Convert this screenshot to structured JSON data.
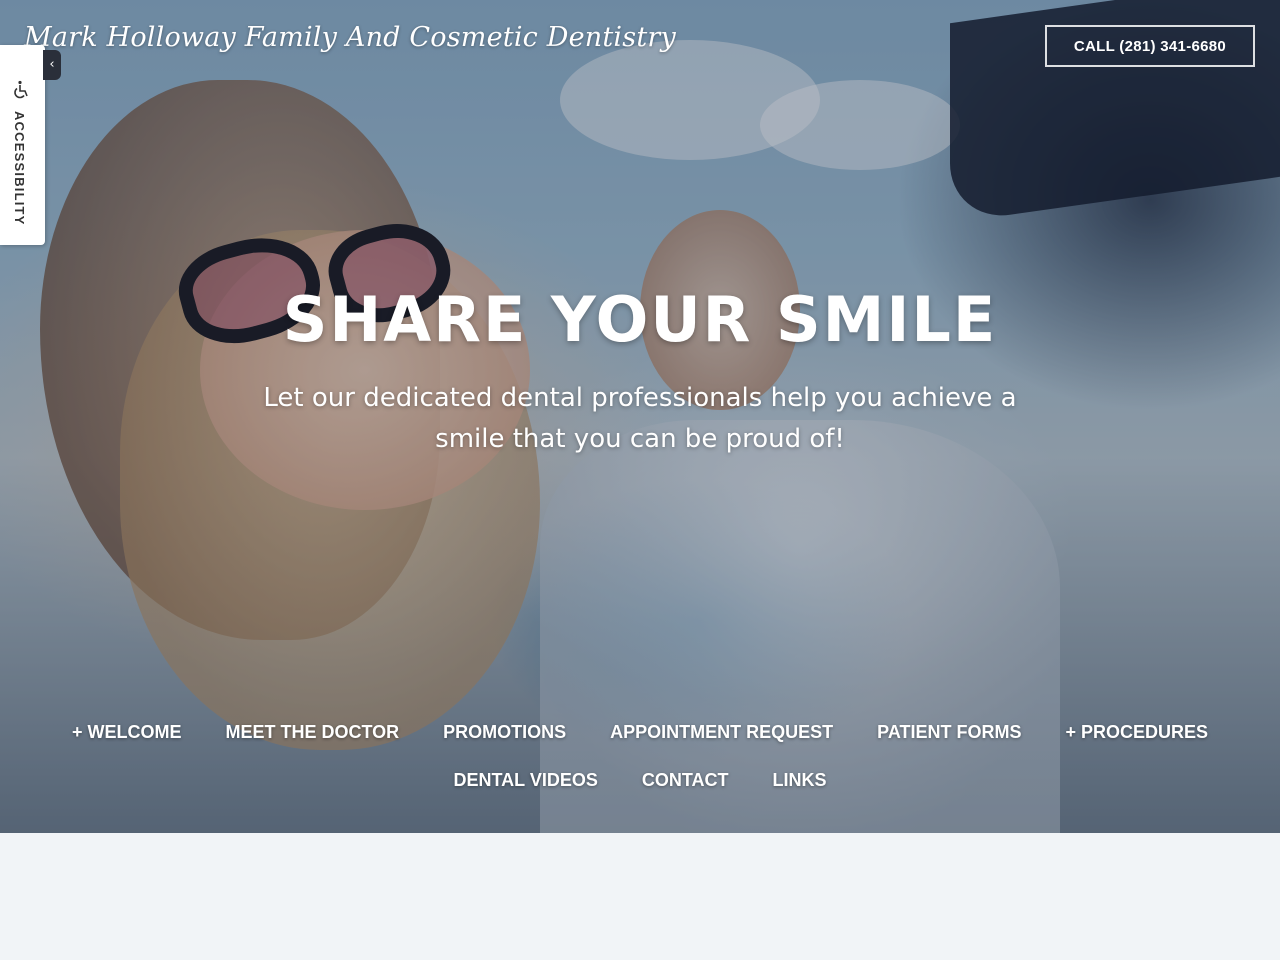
{
  "header": {
    "brand": "Mark Holloway Family And Cosmetic Dentistry",
    "call_button": "CALL (281) 341-6680"
  },
  "accessibility": {
    "label": "ACCESSIBILITY",
    "icon": "wheelchair-icon",
    "toggle_icon": "chevron-left-icon"
  },
  "hero": {
    "headline": "SHARE YOUR SMILE",
    "subhead": "Let our dedicated dental professionals help you achieve a smile that you can be proud of!"
  },
  "nav": {
    "row1": [
      "+ WELCOME",
      "MEET THE DOCTOR",
      "PROMOTIONS",
      "APPOINTMENT REQUEST",
      "PATIENT FORMS",
      "+ PROCEDURES"
    ],
    "row2": [
      "DENTAL VIDEOS",
      "CONTACT",
      "LINKS"
    ]
  },
  "colors": {
    "text_on_hero": "#ffffff",
    "page_background": "#f1f4f7",
    "accessibility_tab": "#ffffff",
    "toggle_background": "#2a2f3a"
  }
}
